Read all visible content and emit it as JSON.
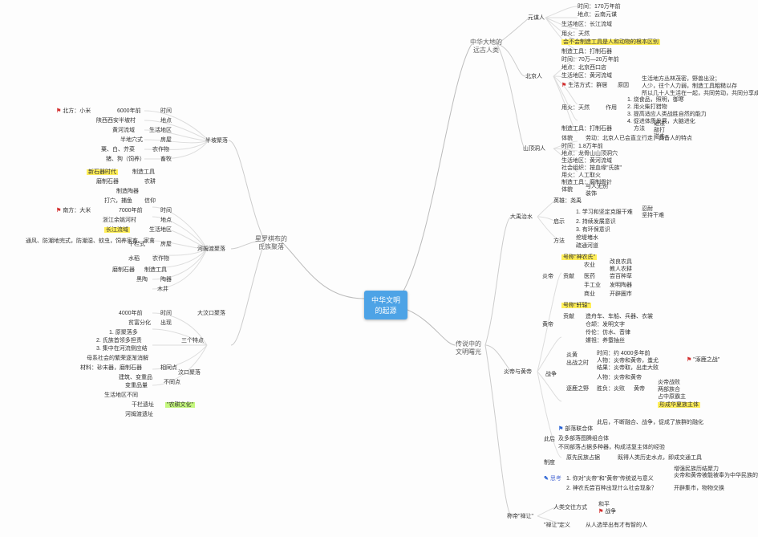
{
  "root": {
    "l1": "中华文明",
    "l2": "的起源"
  },
  "main": {
    "b1": "远古人类",
    "b1b": "中华大地的",
    "b2": "星罗棋布的",
    "b2b": "氏族聚落",
    "b3": "传说中的",
    "b3b": "文明曙光"
  },
  "b1": {
    "yuan": "元谋人",
    "yuan_items": {
      "time": "时间：170万年前",
      "loc": "地点：云南元谋",
      "area": "生活地区：长江流域",
      "fire": "用火：天然",
      "key": "会不会制造工具是人和动物的根本区别",
      "tool": "制造工具：打制石器"
    },
    "bj": "北京人",
    "bj_items": {
      "time": "时间：70万—20万年前",
      "loc": "地点：北京西口店",
      "area": "生活地区：黄河流域",
      "life": "生活方式：群居",
      "reason": "原因",
      "r1": "生活地方丛林茂密，野兽出没；",
      "r2": "人少，往个人力弱，制造工具粗糙以存",
      "r3": "所以几十人生活在一起，共同劳动，共同分享成果，过群居生活",
      "fire": "用火：天然",
      "fn": "作用",
      "f1": "1. 烧食品，照明，御寒",
      "f2": "2. 用火柴打猎物",
      "f3": "3. 提高适应人类战胜自然的能力",
      "f4": "4. 促进体质发展，大脑进化",
      "tool": "制造工具：打制石器",
      "m": "方法",
      "m1": "砸法",
      "m2": "敲打",
      "m3": "碰击",
      "body": "体貌",
      "bodyT": "劳动：北京人已会直立行走，具备人的特点"
    },
    "sd": "山顶洞人",
    "sd_items": {
      "time": "时间：1.8万年前",
      "loc": "地点：龙骨山山顶洞穴",
      "area": "生活地区：黄河流域",
      "org": "社会组织：按血缘\"氏族\"",
      "fire": "用火：人工取火",
      "tool": "制造工具：磨制骨针",
      "body": "体貌",
      "bodyT": "与人无别",
      "rc": "装饰"
    }
  },
  "b2": {
    "age": "新石器时代",
    "age_items": {
      "tool": "制造工具",
      "toolT": "磨制石器",
      "rev": "农耕",
      "revT": "制造陶器",
      "rel": "信仰",
      "relT": "打穴，捕鱼"
    },
    "bp": "半坡聚落",
    "bp_items": {
      "time": "时间",
      "timeV": "6000年前",
      "loc": "地点",
      "locV": "陕西西安半坡村",
      "area": "生活地区",
      "areaV": "黄河流域",
      "house": "房屋",
      "houseV": "半地穴式",
      "crop": "农作物",
      "cropV": "粟、白、芥菜",
      "an": "畜牧",
      "anV": "猪、狗（饲养）",
      "north": "北方：小米"
    },
    "hmd": "河姆渡聚落",
    "hmd_items": {
      "time": "时间",
      "timeV": "7000年前",
      "loc": "地点",
      "locV": "浙江余姚河村",
      "area": "生活地区",
      "areaV": "长江流域",
      "house": "房屋",
      "houseV": "干栏式",
      "houseR": "通风、防潮地完式，防潮湿、蚊虫，饲养家畜、家禽",
      "crop": "农作物",
      "cropV": "水稻",
      "tool": "制造工具",
      "toolV": "磨制石器",
      "pot": "陶器",
      "potV": "黑陶",
      "well": "木井",
      "south": "南方：大米"
    },
    "dwk": "大汶口聚落",
    "dwk_items": {
      "time": "时间",
      "timeV": "4000年前",
      "diff": "贫富分化",
      "diffT": "出现",
      "three": "三个特点",
      "t1": "1. 原聚落多",
      "t2": "2. 氏族首领多担责",
      "t3": "3. 集中在河流侧应结",
      "mat": "母系社会的繁荣逐渐消解",
      "other": "汶口聚落",
      "o1": "材料：砂末器，磨制石器",
      "o2": "建筑、变重品",
      "o3": "变重品量",
      "diffArea": "生活地区不同",
      "feat": "干栏遗址",
      "featT": "\"农耕文化\"",
      "riv": "河姆渡遗址",
      "ot": "不同点",
      "sm": "相同点"
    }
  },
  "b3": {
    "yu": "大禹治水",
    "yu_items": {
      "hero": "英雄：尧禹",
      "ins": "启示",
      "i1": "1. 学习和坚定克服干难",
      "i1a": "忍耐",
      "i1b": "坚持干难",
      "i2": "2. 持续发展意识",
      "i3": "3. 有环保意识",
      "m": "方法",
      "m1": "挖堤堵水",
      "m2": "疏通河道"
    },
    "yan": "炎帝",
    "yan_t": "号称\"神农氏\"",
    "yan_g": "贡献",
    "yan_items": {
      "g1": "农业",
      "g1a": "改良农具",
      "g1b": "教人农耕",
      "g2": "医药",
      "g2a": "尝百种草",
      "g3": "手工业",
      "g3a": "发明陶器",
      "g4": "商业",
      "g4a": "开辟圈市"
    },
    "huang": "黄帝",
    "huang_t": "号称\"轩辕\"",
    "huang_g": "贡献",
    "huang_items": {
      "g1": "造舟车、车船、兵器、衣裳",
      "g2": "仓颉：发明文字",
      "g3": "伶伦：仿水、音律",
      "g4": "嫘祖：养蚕抽丝"
    },
    "war": "战争",
    "war_items": {
      "a": "炎黄",
      "aT": "出战之时",
      "a1": "时间：约 4000多年前",
      "a2": "人物：炎帝和黄帝，蚩尤",
      "a3": "结果：炎帝取，出走大败",
      "aFlag": "\"涿鹿之战\"",
      "b": "逐鹿之野",
      "b1": "人物：炎帝和黄帝",
      "bR": "黄帝",
      "bR1": "炎帝战败",
      "bR2": "两部族合",
      "bR3": "占中原霸主",
      "bHl": "形成华夏族主体",
      "res": "胜负：炎败"
    },
    "yd": "炎帝与黄帝",
    "after": "此后",
    "after_items": {
      "a1": "部落联合体",
      "a1T": "此后，不断融合、战争，促成了族群的融化",
      "a2": "及多部落图腾组合体",
      "a3": "不同部落占据多种器，构成活复主体的经验",
      "res": "制度",
      "r1": "原先民族占据",
      "r1T": "既得人类历史水点，即成交通工具",
      "r2": "增强民族历结聚力"
    },
    "q": "思考",
    "q1": "1. 你对\"炎帝\"和\"黄帝\"传统说与意义",
    "q1a": "炎帝和黄帝被能被奉为中华民族的人文始祖",
    "q2": "2. 神农氏尝百种出现什么社会现象？",
    "q2a": "开辟集市，物物交换",
    "sh": "称帝\"禅让\"",
    "sh_items": {
      "way": "人类交往方式",
      "w1": "和平",
      "w2": "战争",
      "def": "\"禅让\"定义",
      "defT": "从人选举出有才有智的人"
    }
  }
}
